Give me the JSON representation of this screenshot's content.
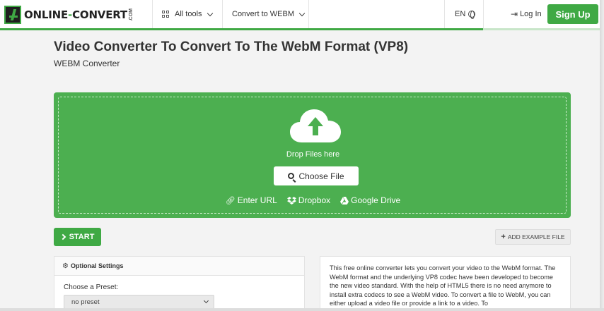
{
  "header": {
    "logo_text_a": "ONLINE",
    "logo_text_dash": "-",
    "logo_text_b": "CONVERT",
    "logo_suffix": ".COM",
    "all_tools_label": "All tools",
    "convert_menu_label": "Convert to WEBM",
    "language_label": "EN",
    "login_label": "Log In",
    "signup_label": "Sign Up",
    "progress_fraction": 0.8,
    "accent_color": "#3fa944"
  },
  "page": {
    "title": "Video Converter To Convert To The WebM Format (VP8)",
    "subtitle": "WEBM Converter"
  },
  "upload": {
    "drop_text": "Drop Files here",
    "choose_file_label": "Choose File",
    "sources": [
      {
        "icon": "link-icon",
        "label": "Enter URL"
      },
      {
        "icon": "dropbox-icon",
        "label": "Dropbox"
      },
      {
        "icon": "google-drive-icon",
        "label": "Google Drive"
      }
    ],
    "zone_color": "#4caf50"
  },
  "actions": {
    "start_label": "START",
    "example_label": "ADD EXAMPLE FILE"
  },
  "settings": {
    "heading": "Optional Settings",
    "preset_label": "Choose a Preset:",
    "preset_value": "no preset"
  },
  "info": {
    "text": "This free online converter lets you convert your video to the WebM format. The WebM format and the underlying VP8 codec have been developed to become the new video standard. With the help of HTML5 there is no need anymore to install extra codecs to see a WebM video. To convert a file to WebM, you can either upload a video file or provide a link to a video. To"
  }
}
